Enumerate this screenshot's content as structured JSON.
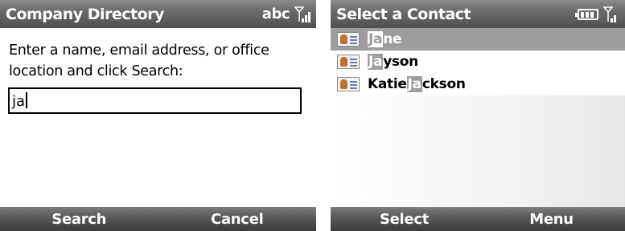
{
  "left_screen": {
    "title": "Company Directory",
    "input_mode": "abc",
    "instruction": "Enter a name, email address, or office location and click Search:",
    "search_value": "ja",
    "softkeys": {
      "left": "Search",
      "right": "Cancel"
    }
  },
  "right_screen": {
    "title": "Select a Contact",
    "contacts": [
      {
        "before": "",
        "match": "Ja",
        "after": "ne",
        "selected": true
      },
      {
        "before": "",
        "match": "Ja",
        "after": "yson",
        "selected": false
      },
      {
        "before": "Katie ",
        "match": "Ja",
        "after": "ckson",
        "selected": false
      }
    ],
    "softkeys": {
      "left": "Select",
      "right": "Menu"
    }
  },
  "colors": {
    "titlebar": "#5c5c5c",
    "selection": "#9e9e9e",
    "text": "#000000"
  },
  "icons": [
    "signal-icon",
    "battery-icon",
    "contact-card-icon"
  ]
}
